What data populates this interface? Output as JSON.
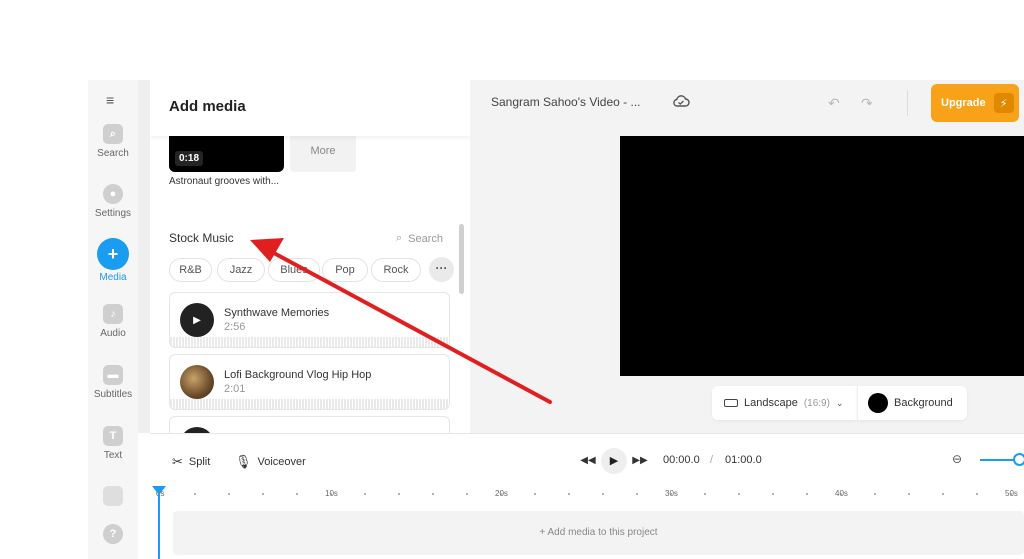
{
  "rail": {
    "items": [
      {
        "label": "Search",
        "icon": "search-icon"
      },
      {
        "label": "Settings",
        "icon": "gear-icon"
      },
      {
        "label": "Media",
        "icon": "plus-icon",
        "active": true
      },
      {
        "label": "Audio",
        "icon": "music-note-icon"
      },
      {
        "label": "Subtitles",
        "icon": "subtitles-icon"
      },
      {
        "label": "Text",
        "icon": "text-icon"
      }
    ],
    "help": "?"
  },
  "panel": {
    "title": "Add media",
    "thumb_time": "0:18",
    "thumb_caption": "Astronaut grooves with...",
    "more_label": "More",
    "stock_title": "Stock Music",
    "search_label": "Search",
    "genres": [
      "R&B",
      "Jazz",
      "Blues",
      "Pop",
      "Rock"
    ],
    "tracks": [
      {
        "name": "Synthwave Memories",
        "duration": "2:56"
      },
      {
        "name": "Lofi Background Vlog Hip Hop",
        "duration": "2:01"
      }
    ]
  },
  "editor": {
    "project_title": "Sangram Sahoo's Video - ...",
    "upgrade_label": "Upgrade",
    "ratio_label": "Landscape",
    "ratio_value": "(16:9)",
    "background_label": "Background"
  },
  "timeline": {
    "split_label": "Split",
    "voiceover_label": "Voiceover",
    "current_time": "00:00.0",
    "separator": "/",
    "total_time": "01:00.0",
    "ticks": [
      "0s",
      "10s",
      "20s",
      "30s",
      "40s",
      "50s"
    ],
    "empty_label": "Add media to this project"
  },
  "colors": {
    "accent": "#1a9cf0",
    "upgrade": "#f8a21a",
    "annotation": "#e02020"
  }
}
